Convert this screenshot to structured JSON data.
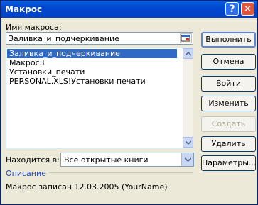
{
  "window": {
    "title": "Макрос"
  },
  "macro_name": {
    "label": "Имя макроса:",
    "value": "Заливка_и_подчеркивание"
  },
  "macro_list": {
    "items": [
      {
        "label": "Заливка_и_подчеркивание",
        "selected": true
      },
      {
        "label": "Макрос3",
        "selected": false
      },
      {
        "label": "Установки_печати",
        "selected": false
      },
      {
        "label": "PERSONAL.XLS!Установки печати",
        "selected": false
      }
    ]
  },
  "location": {
    "label": "Находится в:",
    "value": "Все открытые книги"
  },
  "buttons": {
    "run": "Выполнить",
    "cancel": "Отмена",
    "step_into": "Войти",
    "edit": "Изменить",
    "create": "Создать",
    "delete": "Удалить",
    "options": "Параметры..."
  },
  "description": {
    "label": "Описание",
    "text": "Макрос записан 12.03.2005 (YourName)"
  },
  "colors": {
    "titlebar": "#0047cf",
    "selection": "#316ac5",
    "dialog_bg": "#ece9d8"
  }
}
